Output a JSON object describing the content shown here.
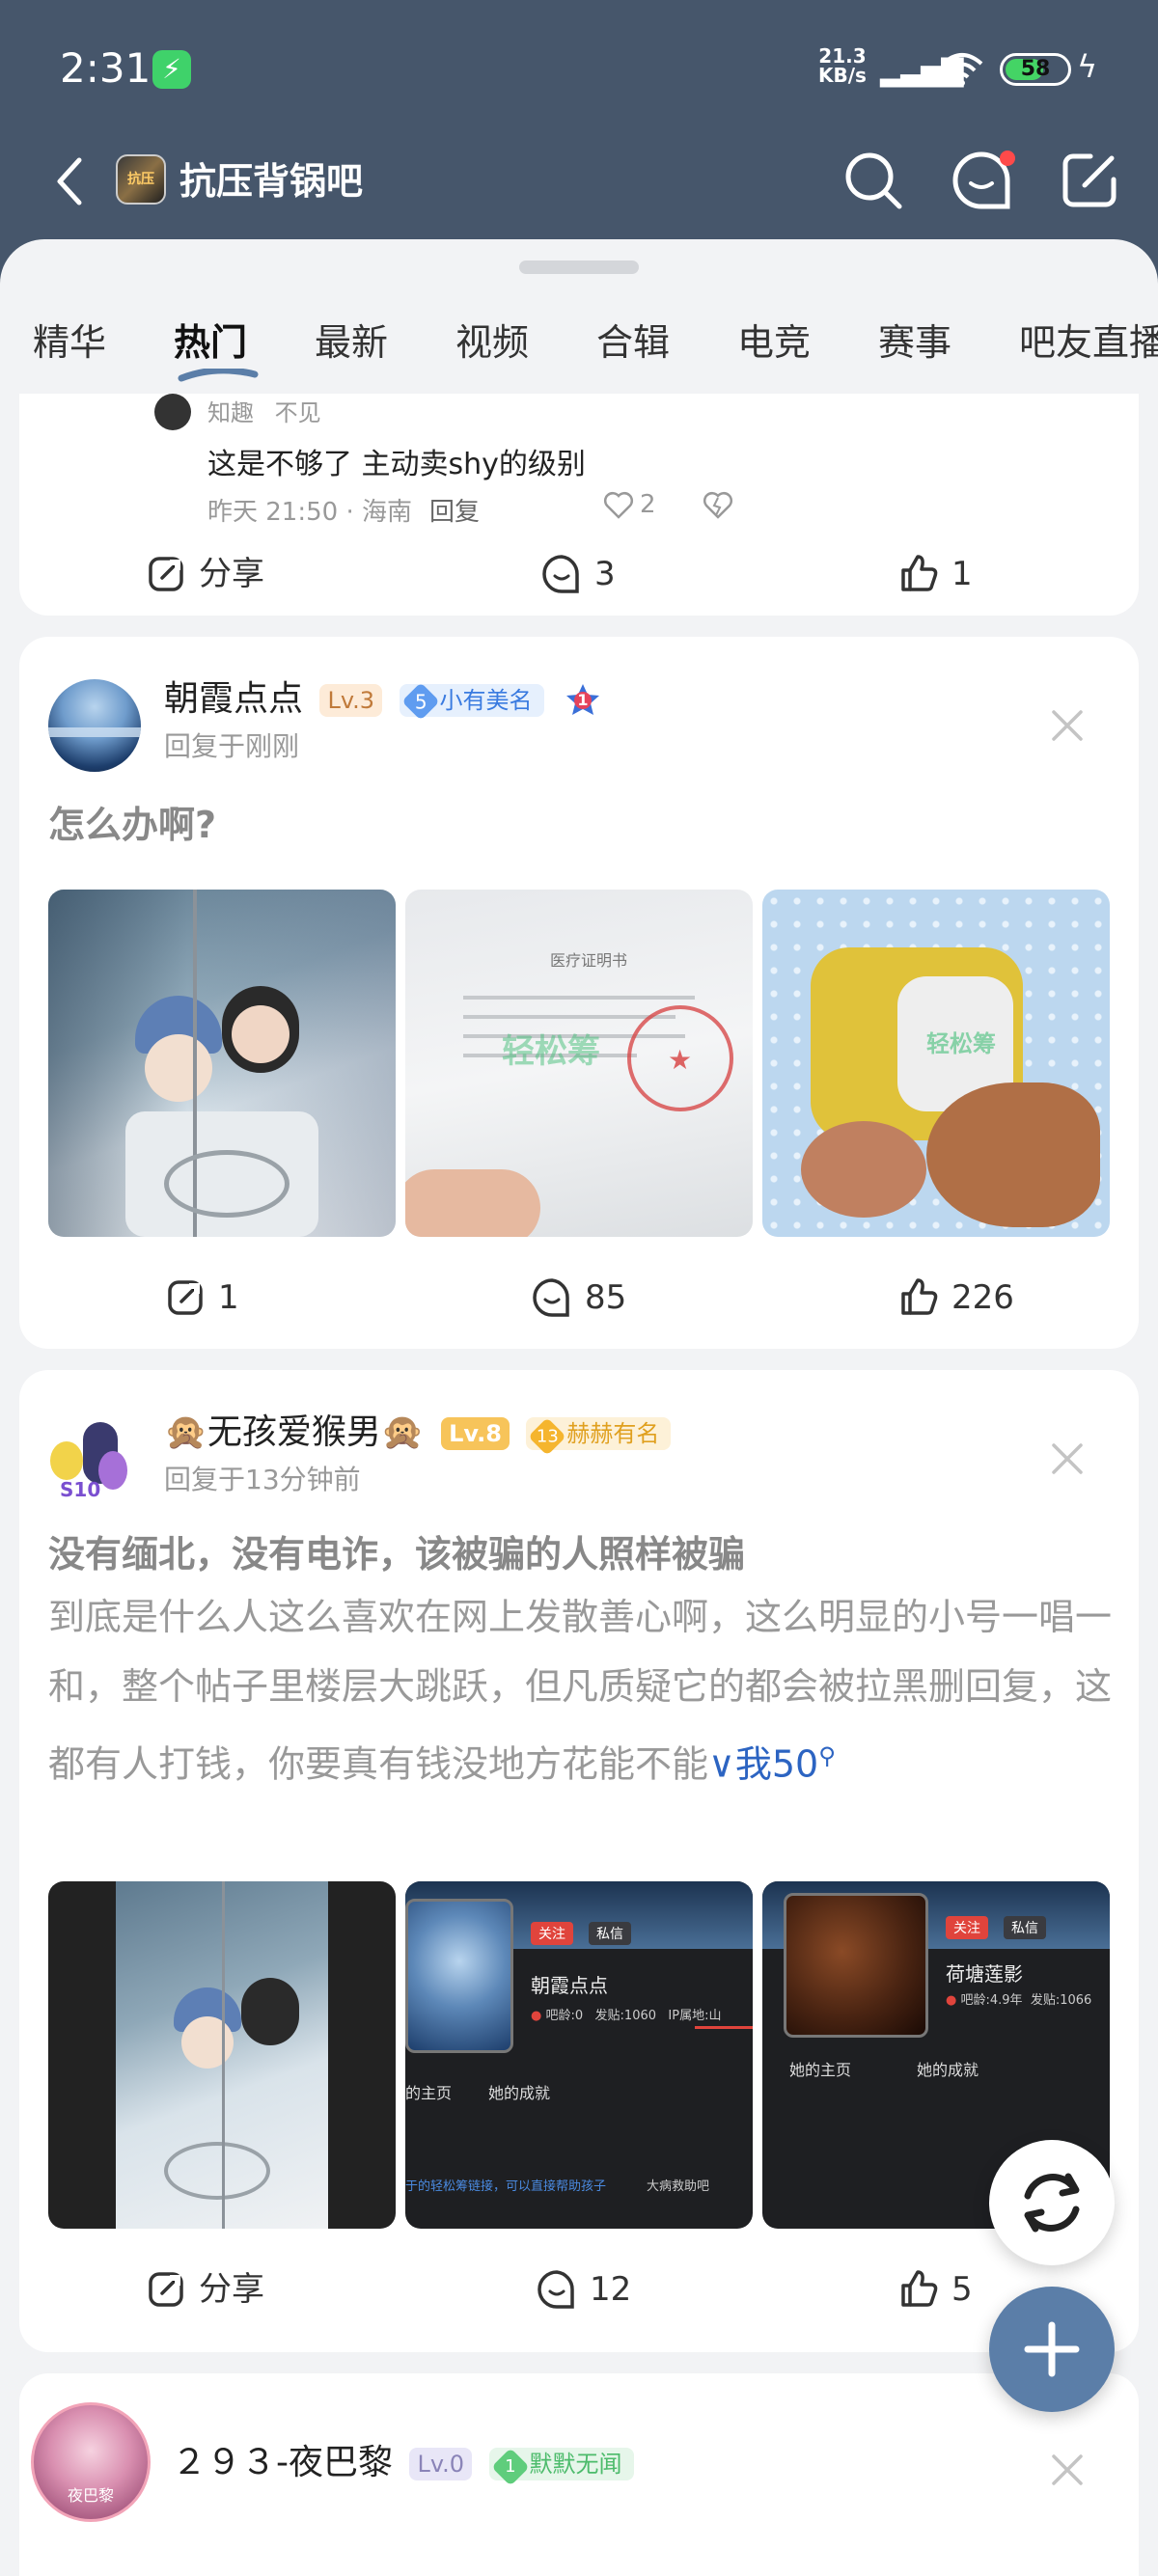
{
  "status_bar": {
    "time": "2:31",
    "net_speed": "21.3",
    "net_unit": "KB/s",
    "battery": "58"
  },
  "header": {
    "bar_name": "抗压背锅吧",
    "logo_text": "抗压"
  },
  "tabs": [
    {
      "label": "精华"
    },
    {
      "label": "热门"
    },
    {
      "label": "最新"
    },
    {
      "label": "视频"
    },
    {
      "label": "合辑"
    },
    {
      "label": "电竞"
    },
    {
      "label": "赛事"
    },
    {
      "label": "吧友直播"
    }
  ],
  "active_tab": "热门",
  "post0": {
    "reply_user": "知趣",
    "reply_tag": "不见",
    "reply_text": "这是不够了  主动卖shy的级别",
    "reply_meta": "昨天 21:50 · 海南",
    "reply_button": "回复",
    "reply_likes": "2",
    "share_label": "分享",
    "comments": "3",
    "likes": "1"
  },
  "post1": {
    "username": "朝霞点点",
    "level": "Lv.3",
    "badge_num": "5",
    "badge_text": "小有美名",
    "rank_num": "1",
    "meta": "回复于刚刚",
    "title": "怎么办啊?",
    "shares": "1",
    "comments": "85",
    "likes": "226",
    "image2_stamp": "轻松筹",
    "image2_doc_title": "医疗证明书"
  },
  "post2": {
    "username": "🙊无孩爱猴男🙊",
    "level": "Lv.8",
    "badge_num": "13",
    "badge_text": "赫赫有名",
    "avatar_tag": "S10",
    "meta": "回复于13分钟前",
    "title": "没有缅北，没有电诈，该被骗的人照样被骗",
    "body": "到底是什么人这么喜欢在网上发散善心啊，这么明显的小号一唱一和，整个帖子里楼层大跳跃，但凡质疑它的都会被拉黑删回复，这都有人打钱，你要真有钱没地方花能不能",
    "more": "∨",
    "more_tail": "我50",
    "share_label": "分享",
    "comments": "12",
    "likes": "5",
    "img2": {
      "follow": "关注",
      "message": "私信",
      "name": "朝霞点点",
      "age": "吧龄:0",
      "posts": "发贴:1060",
      "ip": "IP属地:山",
      "tab_home": "的主页",
      "tab_achieve": "她的成就",
      "footer_text": "于的轻松筹链接，可以直接帮助孩子",
      "footer_bar": "大病救助吧"
    },
    "img3": {
      "follow": "关注",
      "message": "私信",
      "name": "荷塘莲影",
      "age": "吧龄:4.9年",
      "posts": "发贴:1066",
      "tab_home": "她的主页",
      "tab_achieve": "她的成就"
    }
  },
  "post3": {
    "username": "２９３-夜巴黎",
    "level": "Lv.0",
    "badge_num": "1",
    "badge_text": "默默无闻",
    "avatar_text": "夜巴黎"
  }
}
